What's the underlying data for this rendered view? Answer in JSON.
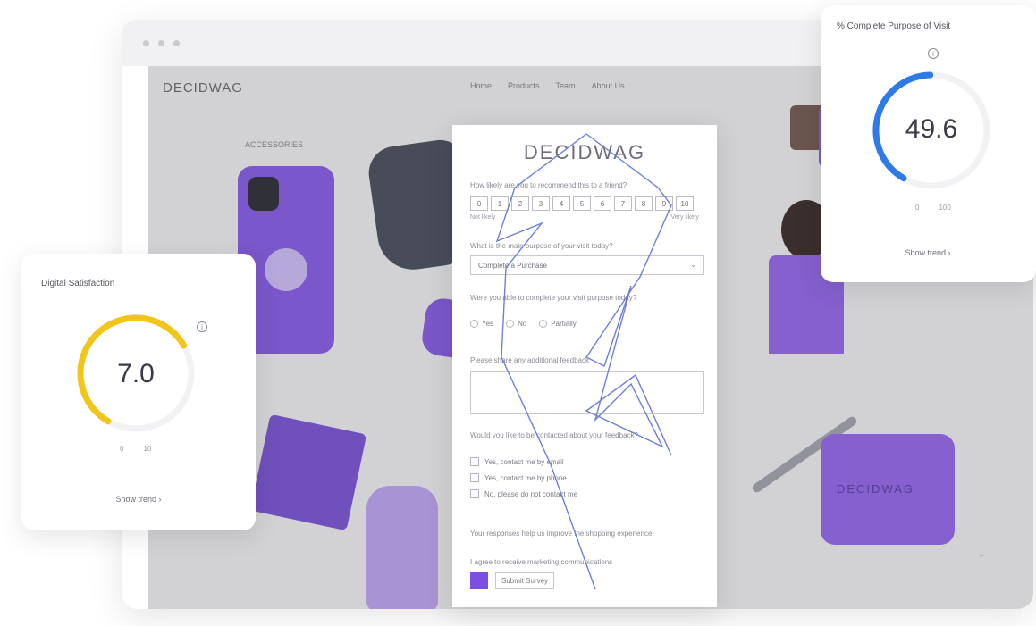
{
  "site": {
    "logo": "DECIDWAG",
    "nav": [
      "Home",
      "Products",
      "Team",
      "About Us"
    ],
    "hero_title": "ACCESSORIES"
  },
  "survey": {
    "logo": "DECIDWAG",
    "q1": "How likely are you to recommend this to a friend?",
    "scale": [
      "0",
      "1",
      "2",
      "3",
      "4",
      "5",
      "6",
      "7",
      "8",
      "9",
      "10"
    ],
    "scale_low": "Not likely",
    "scale_high": "Very likely",
    "q2": "What is the main purpose of your visit today?",
    "q2_selected": "Complete a Purchase",
    "q3": "Were you able to complete your visit purpose today?",
    "q3_options": [
      "Yes",
      "No",
      "Partially"
    ],
    "q4": "Please share any additional feedback",
    "q5": "Would you like to be contacted about your feedback?",
    "q5_options": [
      "Yes, contact me by email",
      "Yes, contact me by phone",
      "No, please do not contact me"
    ],
    "q6": "Your responses help us improve the shopping experience",
    "q7": "I agree to receive marketing communications",
    "submit_label": "Submit Survey"
  },
  "digital_satisfaction": {
    "title": "Digital Satisfaction",
    "value": "7.0",
    "score": 7.0,
    "scale_min": "0",
    "scale_max": "10",
    "link": "Show trend ›",
    "color": "#f2c51a"
  },
  "complete_purpose": {
    "title": "% Complete Purpose of Visit",
    "value": "49.6",
    "score": 49.6,
    "scale_min": "0",
    "scale_max": "100",
    "link": "Show trend ›",
    "color": "#2f7be6"
  },
  "product_pouch_text": "DECIDWAG"
}
